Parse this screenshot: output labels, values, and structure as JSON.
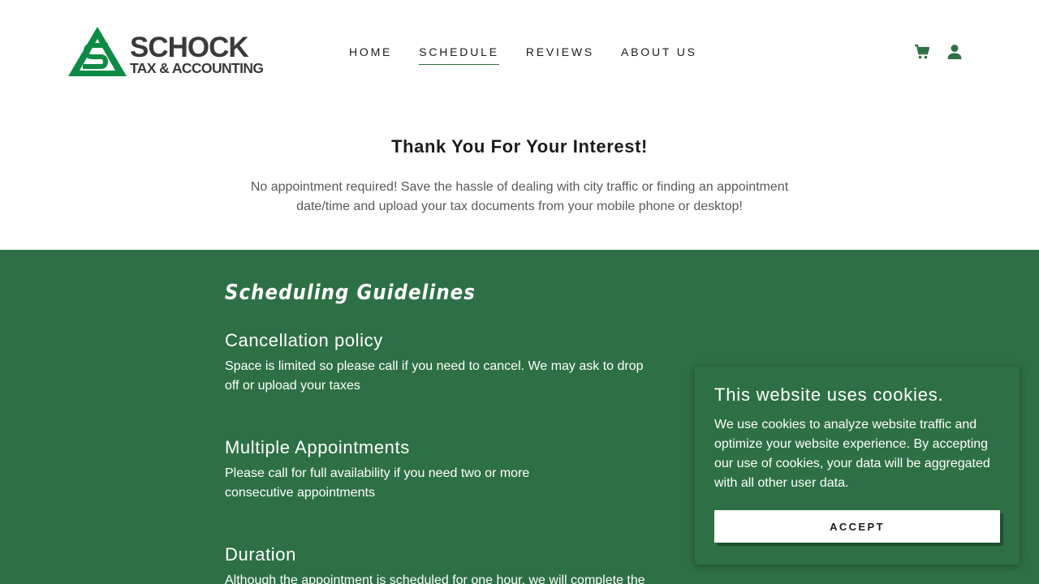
{
  "brand": {
    "name": "SCHOCK",
    "subtitle": "TAX & ACCOUNTING",
    "colors": {
      "green": "#2e7045",
      "logo_green": "#0e8a45",
      "logo_text": "#3a3a3a"
    }
  },
  "nav": {
    "items": [
      {
        "label": "HOME",
        "active": false
      },
      {
        "label": "SCHEDULE",
        "active": true
      },
      {
        "label": "REVIEWS",
        "active": false
      },
      {
        "label": "ABOUT US",
        "active": false
      }
    ],
    "icons": [
      "cart-icon",
      "user-icon"
    ]
  },
  "intro": {
    "title": "Thank You For Your Interest!",
    "text": "No appointment required! Save the hassle of dealing with city traffic or finding an appointment date/time and upload your tax documents from your mobile phone or desktop!"
  },
  "guidelines": {
    "title": "Scheduling Guidelines",
    "items": [
      {
        "heading": "Cancellation policy",
        "text": "Space is limited so please call if you need to cancel. We may ask to drop off or upload your taxes"
      },
      {
        "heading": "Multiple Appointments",
        "text": "Please call for full availability if you need two or more consecutive appointments"
      },
      {
        "heading": "Duration",
        "text": "Although the appointment is scheduled for one hour, we will complete the"
      }
    ]
  },
  "cookie": {
    "title": "This website uses cookies.",
    "text": "We use cookies to analyze website traffic and optimize your website experience. By accepting our use of cookies, your data will be aggregated with all other user data.",
    "accept_label": "ACCEPT"
  }
}
